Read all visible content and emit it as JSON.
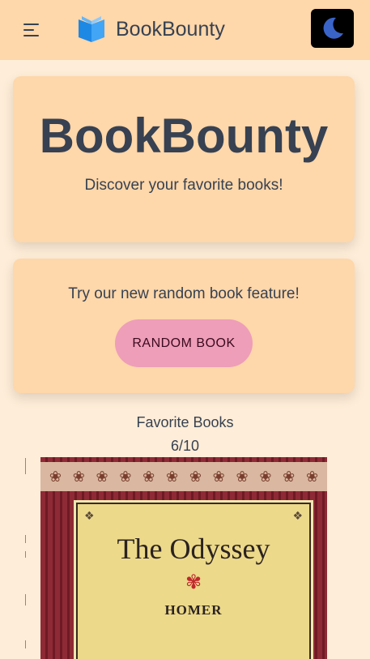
{
  "navbar": {
    "brand": "BookBounty",
    "menu_icon": "hamburger-icon",
    "logo_icon": "open-book-icon",
    "theme_icon": "moon-icon"
  },
  "hero": {
    "title": "BookBounty",
    "subtitle": "Discover your favorite books!"
  },
  "random_card": {
    "text": "Try our new random book feature!",
    "button": "RANDOM BOOK"
  },
  "favorites": {
    "title": "Favorite Books",
    "count": "6/10",
    "current_book": {
      "title": "The Odyssey",
      "author": "HOMER"
    }
  },
  "colors": {
    "background": "#feedd8",
    "navbar": "#fed7aa",
    "card": "#fed7aa",
    "button": "#ee9eb8",
    "text": "#374151"
  }
}
